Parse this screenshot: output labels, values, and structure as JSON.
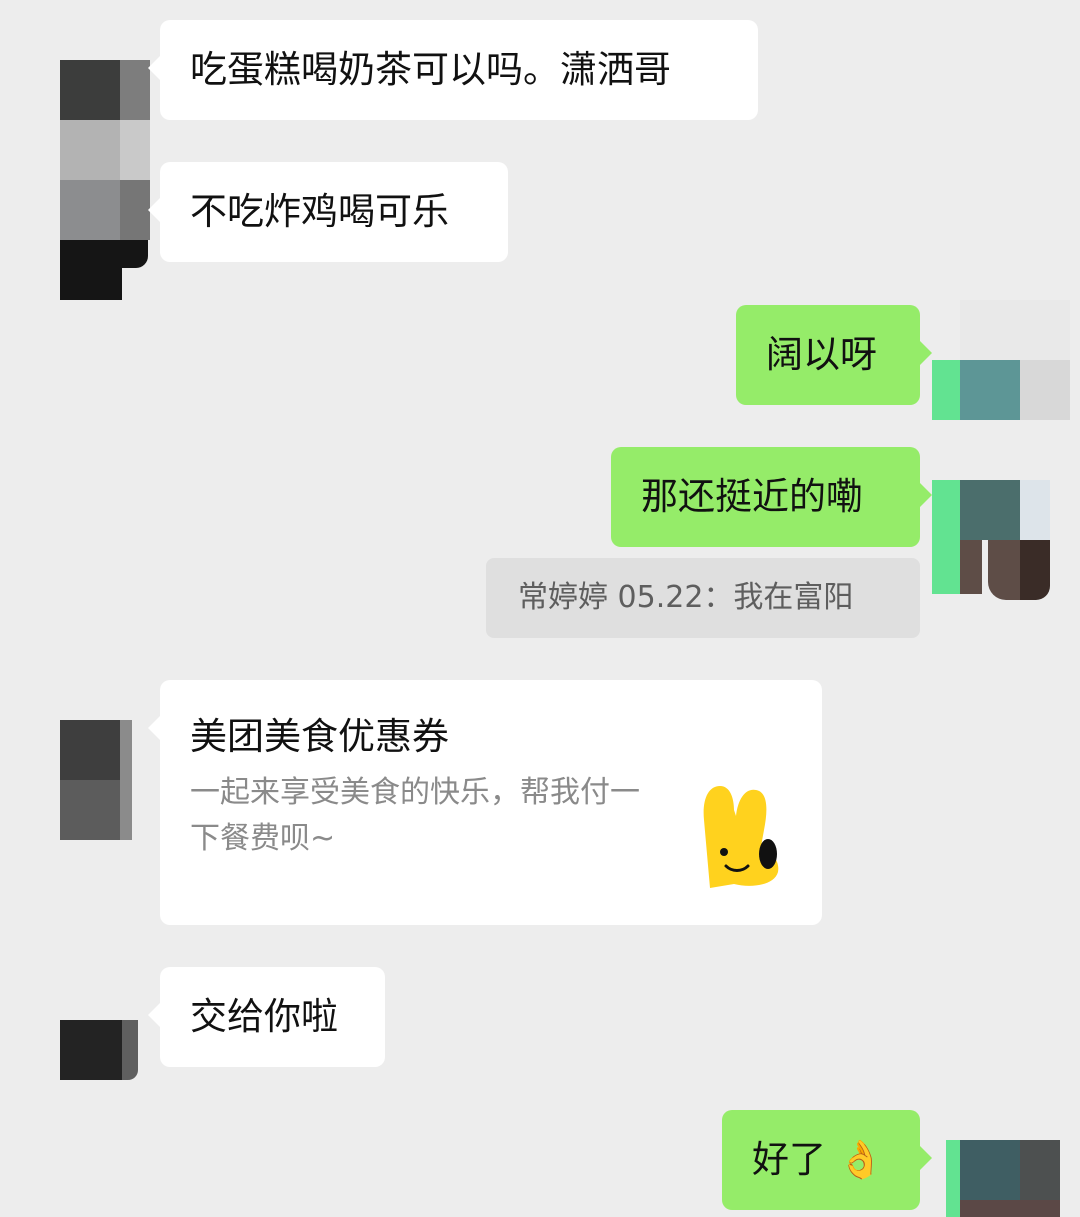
{
  "messages": [
    {
      "side": "left",
      "type": "text",
      "text": "吃蛋糕喝奶茶可以吗。潇洒哥"
    },
    {
      "side": "left",
      "type": "text",
      "text": "不吃炸鸡喝可乐"
    },
    {
      "side": "right",
      "type": "text",
      "text": "阔以呀"
    },
    {
      "side": "right",
      "type": "text",
      "text": "那还挺近的嘞"
    },
    {
      "side": "right",
      "type": "quote",
      "text": "常婷婷 05.22：我在富阳"
    },
    {
      "side": "left",
      "type": "card",
      "title": "美团美食优惠券",
      "description": "一起来享受美食的快乐，帮我付一下餐费呗~"
    },
    {
      "side": "left",
      "type": "text",
      "text": "交给你啦"
    },
    {
      "side": "right",
      "type": "text",
      "text": "好了",
      "emoji": "👌"
    }
  ],
  "colors": {
    "background": "#ededed",
    "incoming_bubble": "#ffffff",
    "outgoing_bubble": "#95ec69",
    "quote_background": "#dfdfdf",
    "mascot_yellow": "#ffd21e"
  },
  "icons": [
    "pixelated-avatar",
    "meituan-kangaroo-icon",
    "ok-hand-emoji"
  ]
}
